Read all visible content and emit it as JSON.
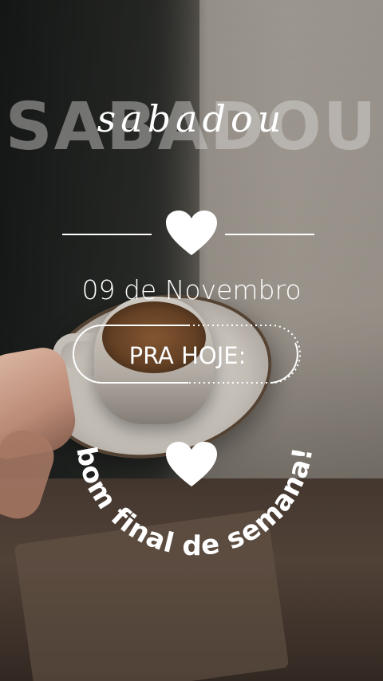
{
  "headline": {
    "background_word": "SABADOU",
    "script_word": "sabadou"
  },
  "date_text": "09 de Novembro",
  "label_pill": "PRA HOJE:",
  "arc_message": "bom final de semana!",
  "icons": {
    "top": "heart-icon",
    "center": "heart-icon"
  },
  "colors": {
    "text": "#ffffff",
    "ghost_text": "#dcdad6"
  }
}
